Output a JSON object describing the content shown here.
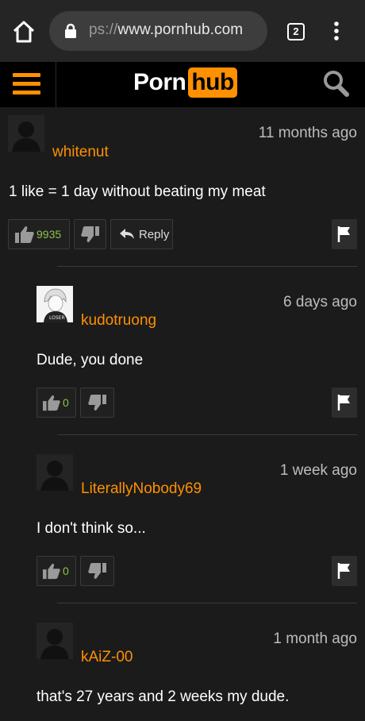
{
  "browser": {
    "url_scheme": "ps://",
    "url_host": "www.pornhub.com",
    "tab_count": "2"
  },
  "site": {
    "logo_left": "Porn",
    "logo_right": "hub"
  },
  "comments": [
    {
      "username": "whitenut",
      "time": "11 months ago",
      "text": "1 like = 1 day without beating my meat",
      "likes": "9935",
      "reply_label": "Reply"
    },
    {
      "username": "kudotruong",
      "time": "6 days ago",
      "text": "Dude, you done",
      "likes": "0"
    },
    {
      "username": "LiterallyNobody69",
      "time": "1 week ago",
      "text": "I don't think so...",
      "likes": "0"
    },
    {
      "username": "kAiZ-00",
      "time": "1 month ago",
      "text": "that's 27 years and 2 weeks my dude."
    }
  ],
  "colors": {
    "accent": "#ff9000",
    "count": "#8bc34a"
  }
}
